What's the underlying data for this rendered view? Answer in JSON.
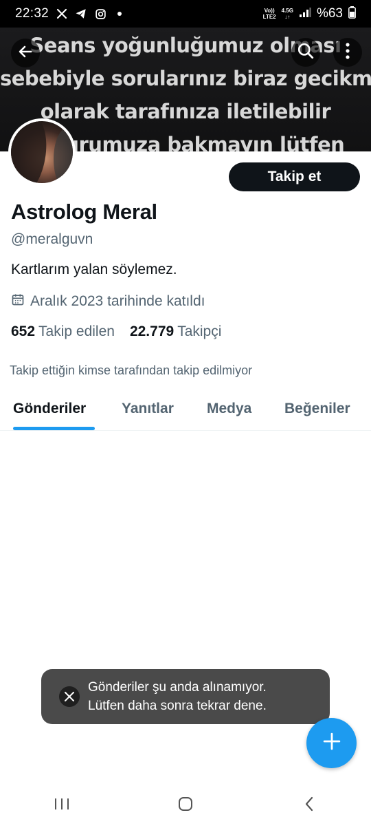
{
  "status_bar": {
    "time": "22:32",
    "volte_top": "Vo))",
    "volte_bottom": "LTE2",
    "network": "4.5G",
    "battery": "%63"
  },
  "banner": {
    "lines": [
      "Seans yoğunluğumuz olması",
      "sebebiyle sorularınız biraz gecikmeli",
      "olarak tarafınıza iletilebilir",
      "kusurumuza bakmayın lütfen"
    ]
  },
  "profile": {
    "name": "Astrolog Meral",
    "handle": "@meralguvn",
    "bio": "Kartlarım yalan söylemez.",
    "joined": "Aralık 2023 tarihinde katıldı",
    "following_count": "652",
    "following_label": "Takip edilen",
    "followers_count": "22.779",
    "followers_label": "Takipçi",
    "follow_button": "Takip et",
    "notice": "Takip ettiğin kimse tarafından takip edilmiyor"
  },
  "tabs": [
    {
      "label": "Gönderiler",
      "active": true
    },
    {
      "label": "Yanıtlar",
      "active": false
    },
    {
      "label": "Medya",
      "active": false
    },
    {
      "label": "Beğeniler",
      "active": false
    }
  ],
  "toast": {
    "line1": "Gönderiler şu anda alınamıyor.",
    "line2": "Lütfen daha sonra tekrar dene."
  },
  "colors": {
    "accent": "#1d9bf0",
    "text_primary": "#0f1419",
    "text_secondary": "#536471",
    "toast_bg": "#4a4a4a"
  },
  "icons": {
    "back": "arrow-left-icon",
    "search": "search-icon",
    "more": "more-vertical-icon",
    "calendar": "calendar-icon",
    "compose": "plus-icon",
    "x_logo": "x-logo-icon"
  }
}
